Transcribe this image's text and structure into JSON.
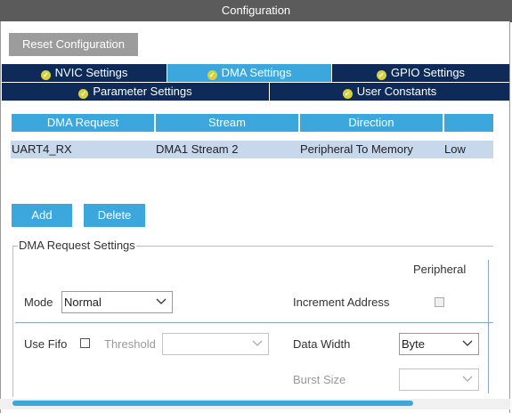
{
  "window": {
    "title": "Configuration"
  },
  "toolbar": {
    "reset_label": "Reset Configuration"
  },
  "tabs": {
    "row1": [
      {
        "label": "NVIC Settings",
        "active": false
      },
      {
        "label": "DMA Settings",
        "active": true
      },
      {
        "label": "GPIO Settings",
        "active": false
      }
    ],
    "row2": [
      {
        "label": "Parameter Settings",
        "active": false
      },
      {
        "label": "User Constants",
        "active": false
      }
    ]
  },
  "table": {
    "headers": [
      "DMA Request",
      "Stream",
      "Direction",
      ""
    ],
    "rows": [
      [
        "UART4_RX",
        "DMA1 Stream 2",
        "Peripheral To Memory",
        "Low"
      ]
    ]
  },
  "actions": {
    "add_label": "Add",
    "delete_label": "Delete"
  },
  "settings": {
    "group_title": "DMA Request Settings",
    "peripheral_header": "Peripheral",
    "mode_label": "Mode",
    "mode_value": "Normal",
    "increment_label": "Increment Address",
    "increment_checked": false,
    "use_fifo_label": "Use Fifo",
    "use_fifo_checked": false,
    "threshold_label": "Threshold",
    "threshold_value": "",
    "data_width_label": "Data Width",
    "data_width_value": "Byte",
    "burst_size_label": "Burst Size",
    "burst_size_value": ""
  },
  "colors": {
    "title_bar": "#5b5b5b",
    "tab_dark": "#0d2a58",
    "tab_active": "#3ca7dd",
    "accent": "#3ca7dd",
    "row_selected": "#c7d8ec",
    "reset_button": "#9c9c9c",
    "check_badge": "#d6d23a"
  }
}
